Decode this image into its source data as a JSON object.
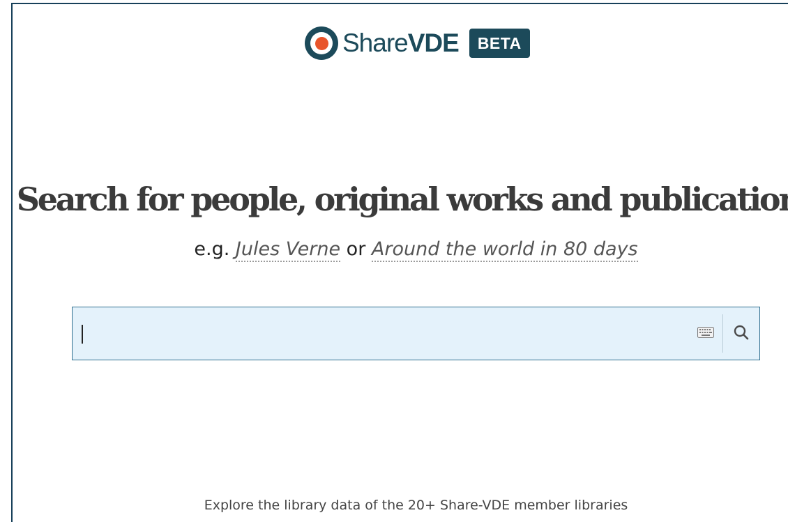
{
  "brand": {
    "name_part1": "Share",
    "name_part2": "VDE",
    "badge": "BETA",
    "colors": {
      "primary": "#1c4a5a",
      "accent": "#e8542a"
    }
  },
  "hero": {
    "headline": "Search for people, original works and publications",
    "example_prefix": "e.g.",
    "example_1": "Jules Verne",
    "example_joiner": "or",
    "example_2": "Around the world in 80 days"
  },
  "search": {
    "value": "",
    "placeholder": "",
    "keyboard_icon": "keyboard-icon",
    "search_icon": "search-icon"
  },
  "footer": {
    "text": "Explore the library data of the 20+ Share-VDE member libraries"
  }
}
